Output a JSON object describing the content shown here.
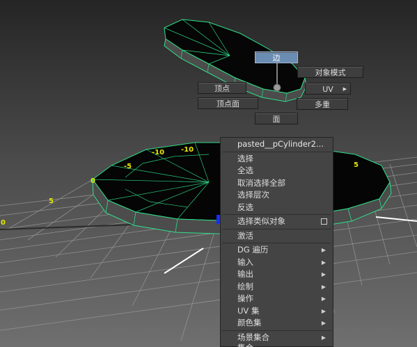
{
  "viewport": {
    "grid_numbers": [
      "-10",
      "-10",
      "-5",
      "0",
      "5",
      "5",
      "0"
    ]
  },
  "marking_menu": {
    "edge": "边",
    "object_mode": "对象模式",
    "vertex": "顶点",
    "uv": "UV",
    "vertex_face": "顶点面",
    "multi": "多重",
    "face": "面"
  },
  "context_menu": {
    "header": "pasted__pCylinder2...",
    "items": [
      "选择",
      "全选",
      "取消选择全部",
      "选择层次",
      "反选"
    ],
    "select_similar": "选择类似对象",
    "activate": "激活",
    "submenus": [
      "DG 遍历",
      "输入",
      "输出",
      "绘制",
      "操作",
      "UV 集",
      "颜色集"
    ],
    "scene_sets": "场景集合",
    "partial": "集合"
  },
  "colors": {
    "wire_highlight": "#2fe08a",
    "grid_number": "#e8e800",
    "mesh_fill": "#4c4c4c",
    "menu_bg": "#444444",
    "menu_active": "#6b8cb3"
  }
}
